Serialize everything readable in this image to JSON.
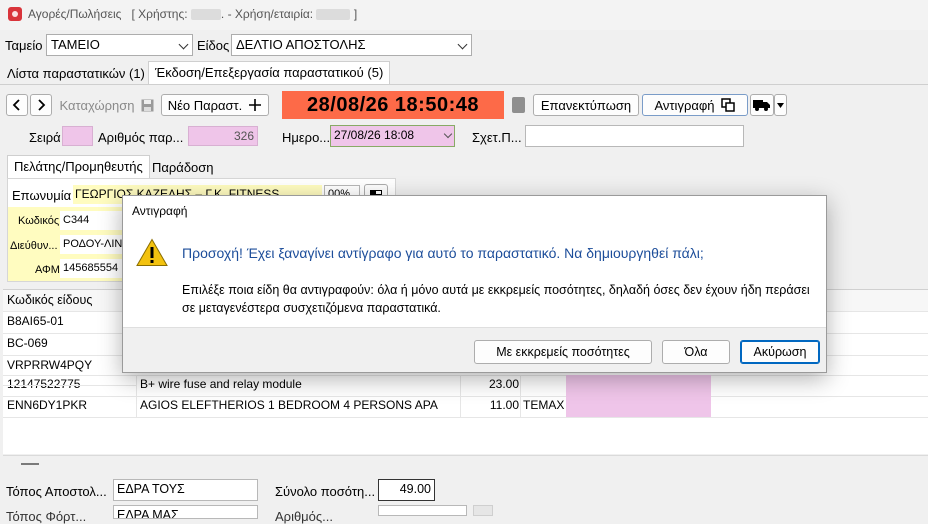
{
  "window": {
    "title_app": "Αγορές/Πωλήσεις",
    "title_user_prefix": "[ Χρήστης:",
    "title_user_suffix": ". - Χρήση/εταιρία:",
    "title_end": "]"
  },
  "top": {
    "tameio_label": "Ταμείο",
    "tameio_value": "ΤΑΜΕΙΟ",
    "eidos_label": "Είδος",
    "eidos_value": "ΔΕΛΤΙΟ ΑΠΟΣΤΟΛΗΣ"
  },
  "tabs": [
    {
      "label": "Λίστα παραστατικών (1)"
    },
    {
      "label": "Έκδοση/Επεξεργασία παραστατικού (5)"
    }
  ],
  "toolbar": {
    "save_label": "Καταχώρηση",
    "new_label": "Νέο Παραστ.",
    "clock": "28/08/26 18:50:48",
    "reprint_label": "Επανεκτύπωση",
    "copy_label": "Αντιγραφή"
  },
  "header_fields": {
    "seira_label": "Σειρά",
    "arithmos_label": "Αριθμός παρ...",
    "arithmos_value": "326",
    "date_label": "Ημερο...",
    "date_value": "27/08/26 18:08",
    "related_label": "Σχετ.Π..."
  },
  "subtabs": [
    {
      "label": "Πελάτης/Προμηθευτής"
    },
    {
      "label": "Παράδοση"
    }
  ],
  "customer": {
    "name_label": "Επωνυμία",
    "name_value": "ΓΕΩΡΓΙΟΣ ΚΑΖΕΛΗΣ – Γ.Κ. FITNESS...",
    "pct_value": "00%",
    "code_label": "Κωδικός",
    "code_value": "C344",
    "address_label": "Διεύθυν...",
    "address_value": "ΡΟΔΟΥ-ΛΙΝ",
    "afm_label": "ΑΦΜ",
    "afm_value": "145685554"
  },
  "table": {
    "col_code": "Κωδικός είδους",
    "rows": [
      {
        "code": "B8AI65-01",
        "desc": "",
        "qty": "",
        "unit": ""
      },
      {
        "code": "BC-069",
        "desc": "",
        "qty": "",
        "unit": ""
      },
      {
        "code": "VRPRRW4PQY",
        "desc": "",
        "qty": "",
        "unit": ""
      },
      {
        "code": "12147522775",
        "desc": "B+ wire fuse and relay module",
        "qty": "23.00",
        "unit": ""
      },
      {
        "code": "ENN6DY1PKR",
        "desc": "AGIOS ELEFTHERIOS 1 BEDROOM 4 PERSONS APA",
        "qty": "11.00",
        "unit": "ΤΕΜΑΧ"
      }
    ]
  },
  "bottom": {
    "topos_label": "Τόπος Αποστολ...",
    "topos_value": "ΕΔΡΑ ΤΟΥΣ",
    "total_label": "Σύνολο ποσότη...",
    "total_value": "49.00",
    "row2_label": "Τόπος Φόρτ...",
    "row2_value": "ΕΔΡΑ ΜΑΣ",
    "row2_label_b": "Αριθμός..."
  },
  "dialog": {
    "title": "Αντιγραφή",
    "headline": "Προσοχή! Έχει ξαναγίνει αντίγραφο για αυτό το παραστατικό. Να δημιουργηθεί πάλι;",
    "detail": "Επιλέξε ποια είδη θα αντιγραφούν: όλα ή μόνο αυτά με εκκρεμείς ποσότητες, δηλαδή όσες δεν έχουν ήδη περάσει σε μεταγενέστερα συσχετιζόμενα παραστατικά.",
    "btn_pending": "Με εκκρεμείς ποσότητες",
    "btn_all": "Όλα",
    "btn_cancel": "Ακύρωση"
  }
}
